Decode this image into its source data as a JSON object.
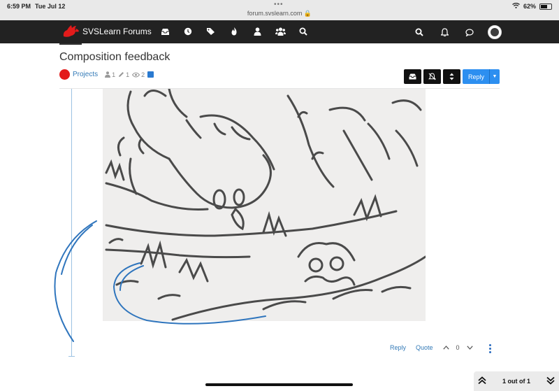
{
  "status": {
    "time": "6:59 PM",
    "date": "Tue Jul 12",
    "url": "forum.svslearn.com",
    "battery": "62%"
  },
  "nav": {
    "brand": "SVSLearn Forums",
    "icons": [
      "inbox-icon",
      "clock-icon",
      "tags-icon",
      "fire-icon",
      "user-icon",
      "users-icon",
      "search-icon"
    ],
    "right_icons": [
      "search-icon",
      "bell-icon",
      "chat-icon",
      "avatar"
    ]
  },
  "topic": {
    "title": "Composition feedback",
    "category": "Projects",
    "category_color": "#e31b1b",
    "posters": "1",
    "posts": "1",
    "views": "2"
  },
  "tools": {
    "reply_label": "Reply",
    "reply_color": "#2d8ff0"
  },
  "post": {
    "reply_link": "Reply",
    "quote_link": "Quote",
    "votes": "0"
  },
  "pager": {
    "label": "1 out of 1"
  }
}
